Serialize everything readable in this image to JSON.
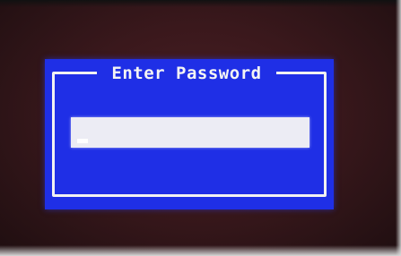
{
  "dialog": {
    "title": "Enter Password",
    "password_value": ""
  },
  "colors": {
    "dialog_background": "#1f2fe6",
    "frame_border": "#f2f2f2",
    "input_background": "#ececf4",
    "screen_background": "#3a181c"
  }
}
